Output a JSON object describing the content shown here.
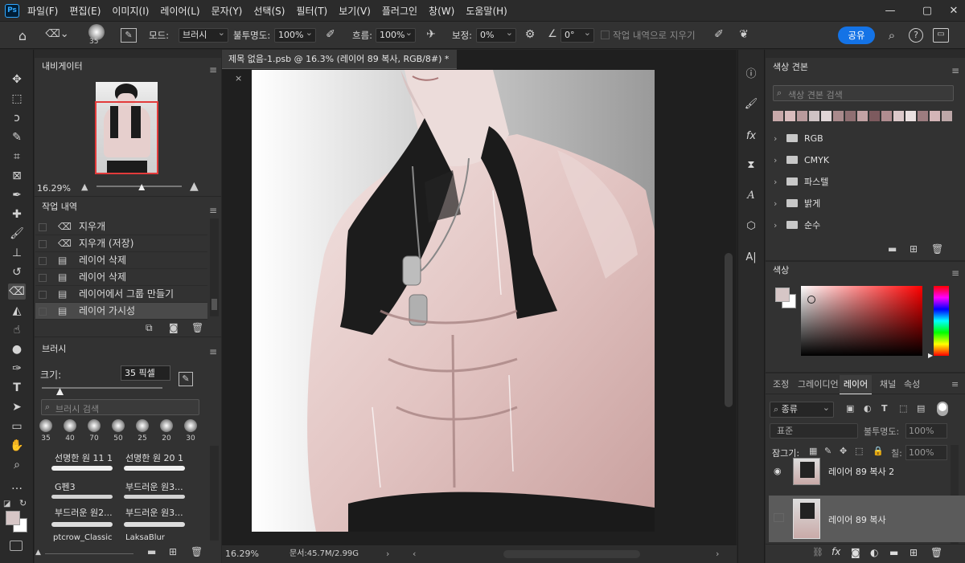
{
  "app": {
    "badge": "Ps"
  },
  "menu": [
    "파일(F)",
    "편집(E)",
    "이미지(I)",
    "레이어(L)",
    "문자(Y)",
    "선택(S)",
    "필터(T)",
    "보기(V)",
    "플러그인",
    "창(W)",
    "도움말(H)"
  ],
  "window_controls": {
    "minimize": "—",
    "maximize": "▢",
    "close": "✕"
  },
  "options": {
    "brush_size": "35",
    "mode_label": "모드:",
    "mode_value": "브러시",
    "opacity_label": "불투명도:",
    "opacity_value": "100%",
    "flow_label": "흐름:",
    "flow_value": "100%",
    "smoothing_label": "보정:",
    "smoothing_value": "0%",
    "angle_value": "0°",
    "erase_history_label": "작업 내역으로 지우기",
    "share_label": "공유"
  },
  "navigator": {
    "title": "내비게이터",
    "zoom": "16.29%",
    "zoom_fraction": 0.53
  },
  "history": {
    "title": "작업 내역",
    "items": [
      {
        "icon": "eraser-icon",
        "label": "지우개"
      },
      {
        "icon": "eraser-icon",
        "label": "지우개 (저장)"
      },
      {
        "icon": "document-icon",
        "label": "레이어 삭제"
      },
      {
        "icon": "document-icon",
        "label": "레이어 삭제"
      },
      {
        "icon": "document-icon",
        "label": "레이어에서 그룹 만들기"
      },
      {
        "icon": "document-icon",
        "label": "레이어 가시성"
      }
    ]
  },
  "brushes": {
    "title": "브러시",
    "size_label": "크기:",
    "size_value": "35 픽셀",
    "size_fraction": 0.12,
    "search_placeholder": "브러시 검색",
    "recent_sizes": [
      "35",
      "40",
      "70",
      "50",
      "25",
      "20",
      "30"
    ],
    "presets": [
      "선명한 원 11 1",
      "선명한 원 20 1",
      "G펜3",
      "부드러운 원3...",
      "부드러운 원2...",
      "부드러운 원3...",
      "ptcrow_Classic",
      "LaksaBlur"
    ]
  },
  "document": {
    "tab_title": "제목 없음-1.psb @ 16.3% (레이어 89 복사, RGB/8#) *",
    "status_zoom": "16.29%",
    "status_doc": "문서:45.7M/2.99G"
  },
  "swatches": {
    "title": "색상 견본",
    "search_placeholder": "색상 견본 검색",
    "colors": [
      "#c8a9aa",
      "#d9bcbd",
      "#b99a9c",
      "#cfc3c4",
      "#e0d6d7",
      "#a98a8c",
      "#8f6f72",
      "#c3a2a4",
      "#7d5a5e",
      "#b08d90",
      "#dcc9ca",
      "#eae0e0",
      "#9d7c7f",
      "#d3b5b7",
      "#bda7a8"
    ],
    "groups": [
      "RGB",
      "CMYK",
      "파스텔",
      "밝게",
      "순수"
    ]
  },
  "color": {
    "title": "색상",
    "foreground": "#d6c6c6",
    "background": "#ffffff"
  },
  "layers_panel": {
    "tabs": [
      "조정",
      "그레이디언",
      "레이어",
      "채널",
      "속성"
    ],
    "active_tab": "레이어",
    "filter_label": "종류",
    "blend_mode": "표준",
    "opacity_label": "불투명도:",
    "opacity_value": "100%",
    "lock_label": "잠그기:",
    "fill_label": "칠:",
    "fill_value": "100%",
    "layers": [
      {
        "name": "레이어 89 복사 2",
        "visible": true,
        "selected": false
      },
      {
        "name": "레이어 89 복사",
        "visible": false,
        "selected": true
      }
    ]
  }
}
